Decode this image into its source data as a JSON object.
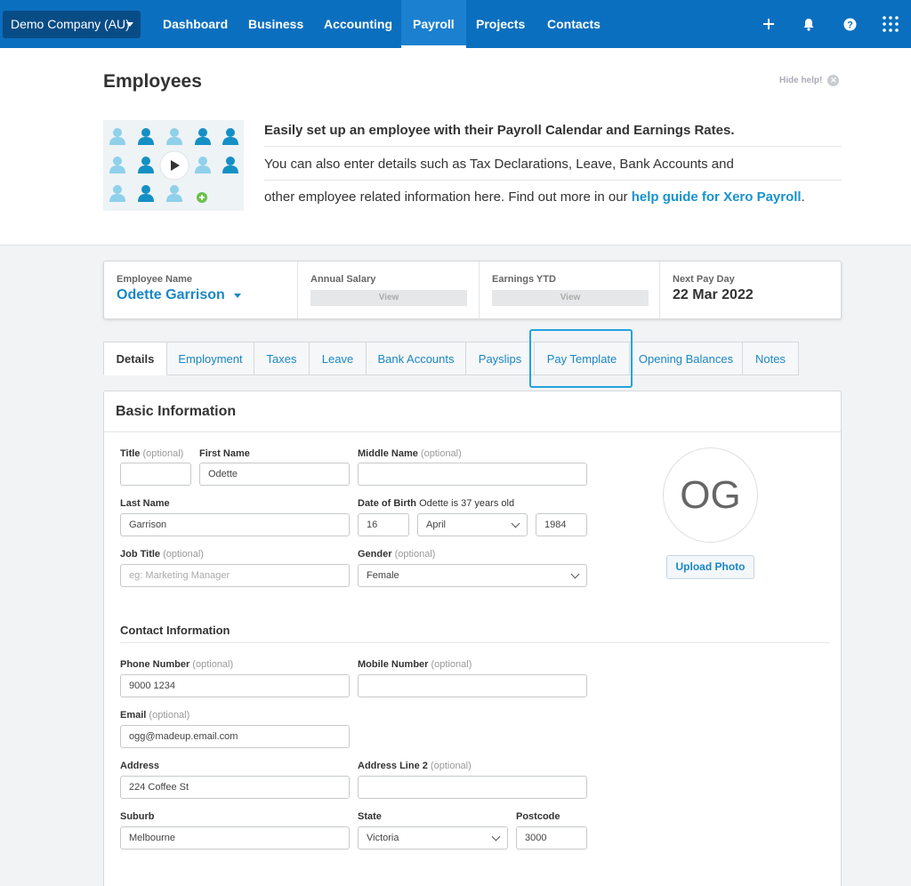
{
  "nav": {
    "org_name": "Demo Company (AU)",
    "items": [
      "Dashboard",
      "Business",
      "Accounting",
      "Payroll",
      "Projects",
      "Contacts"
    ],
    "active": "Payroll",
    "icons": [
      "plus-icon",
      "bell-icon",
      "help-icon",
      "app-grid-icon"
    ],
    "brand_color": "#0b6fbf"
  },
  "page": {
    "title": "Employees",
    "hide_help": "Hide help!"
  },
  "help": {
    "headline": "Easily set up an employee with their Payroll Calendar and Earnings Rates.",
    "line2": "You can also enter details such as Tax Declarations, Leave, Bank Accounts and",
    "line3_prefix": "other employee related information here. Find out more in our ",
    "link": "help guide for Xero Payroll",
    "line3_suffix": "."
  },
  "summary": {
    "employee_label": "Employee Name",
    "employee_name": "Odette Garrison",
    "salary_label": "Annual Salary",
    "salary_value": "View",
    "earnings_label": "Earnings YTD",
    "earnings_value": "View",
    "payday_label": "Next Pay Day",
    "payday_value": "22 Mar 2022"
  },
  "tabs": [
    "Details",
    "Employment",
    "Taxes",
    "Leave",
    "Bank Accounts",
    "Payslips",
    "Pay Template",
    "Opening Balances",
    "Notes"
  ],
  "active_tab": "Details",
  "highlight_tab": "Pay Template",
  "basic": {
    "heading": "Basic Information",
    "title_label": "Title",
    "title_opt": "(optional)",
    "title_value": "",
    "first_label": "First Name",
    "first_value": "Odette",
    "middle_label": "Middle Name",
    "middle_opt": "(optional)",
    "middle_value": "",
    "last_label": "Last Name",
    "last_value": "Garrison",
    "dob_label": "Date of Birth",
    "dob_note": "Odette is 37 years old",
    "dob_day": "16",
    "dob_month": "April",
    "dob_year": "1984",
    "job_label": "Job Title",
    "job_opt": "(optional)",
    "job_placeholder": "eg: Marketing Manager",
    "gender_label": "Gender",
    "gender_opt": "(optional)",
    "gender_value": "Female",
    "initials": "OG",
    "upload": "Upload Photo"
  },
  "contact": {
    "heading": "Contact Information",
    "phone_label": "Phone Number",
    "phone_opt": "(optional)",
    "phone_value": "9000 1234",
    "mobile_label": "Mobile Number",
    "mobile_opt": "(optional)",
    "mobile_value": "",
    "email_label": "Email",
    "email_opt": "(optional)",
    "email_value": "ogg@madeup.email.com",
    "address_label": "Address",
    "address_value": "224 Coffee St",
    "address2_label": "Address Line 2",
    "address2_opt": "(optional)",
    "address2_value": "",
    "suburb_label": "Suburb",
    "suburb_value": "Melbourne",
    "state_label": "State",
    "state_value": "Victoria",
    "postcode_label": "Postcode",
    "postcode_value": "3000"
  }
}
